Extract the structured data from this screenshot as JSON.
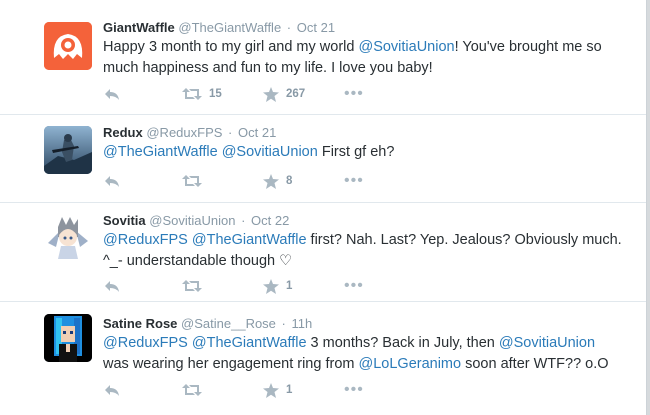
{
  "tweets": [
    {
      "name": "GiantWaffle",
      "handle": "@TheGiantWaffle",
      "time": "Oct 21",
      "text_parts": [
        "Happy 3 month to my girl and my world ",
        "@SovitiaUnion",
        "! You've brought me so much happiness and fun to my life. I love you baby!"
      ],
      "retweets": "15",
      "favorites": "267",
      "avatar_icon": "monster-logo-icon",
      "avatar_color": "#f4623a"
    },
    {
      "name": "Redux",
      "handle": "@ReduxFPS",
      "time": "Oct 21",
      "text_parts": [
        "@TheGiantWaffle",
        " ",
        "@SovitiaUnion",
        " First gf eh?"
      ],
      "retweets": "",
      "favorites": "8",
      "avatar_icon": "soldier-scene-icon",
      "avatar_color": "#4a6f8f"
    },
    {
      "name": "Sovitia",
      "handle": "@SovitiaUnion",
      "time": "Oct 22",
      "text_parts": [
        "@ReduxFPS",
        " ",
        "@TheGiantWaffle",
        " first? Nah. Last? Yep. Jealous? Obviously much. ^_- understandable though ♡"
      ],
      "retweets": "",
      "favorites": "1",
      "avatar_icon": "anime-character-icon",
      "avatar_color": "#9fb0c8"
    },
    {
      "name": "Satine Rose",
      "handle": "@Satine__Rose",
      "time": "11h",
      "text_parts": [
        "@ReduxFPS",
        " ",
        "@TheGiantWaffle",
        " 3 months? Back in July, then ",
        "@SovitiaUnion",
        " was wearing her engagement ring from ",
        "@LoLGeranimo",
        " soon after WTF?? o.O"
      ],
      "retweets": "",
      "favorites": "1",
      "avatar_icon": "pixel-character-icon",
      "avatar_color": "#0b1a2e"
    }
  ],
  "ui": {
    "more_glyph": "•••"
  },
  "colors": {
    "mention": "#2b7bb9",
    "meta": "#8899a6",
    "icon": "#aab8c2"
  }
}
